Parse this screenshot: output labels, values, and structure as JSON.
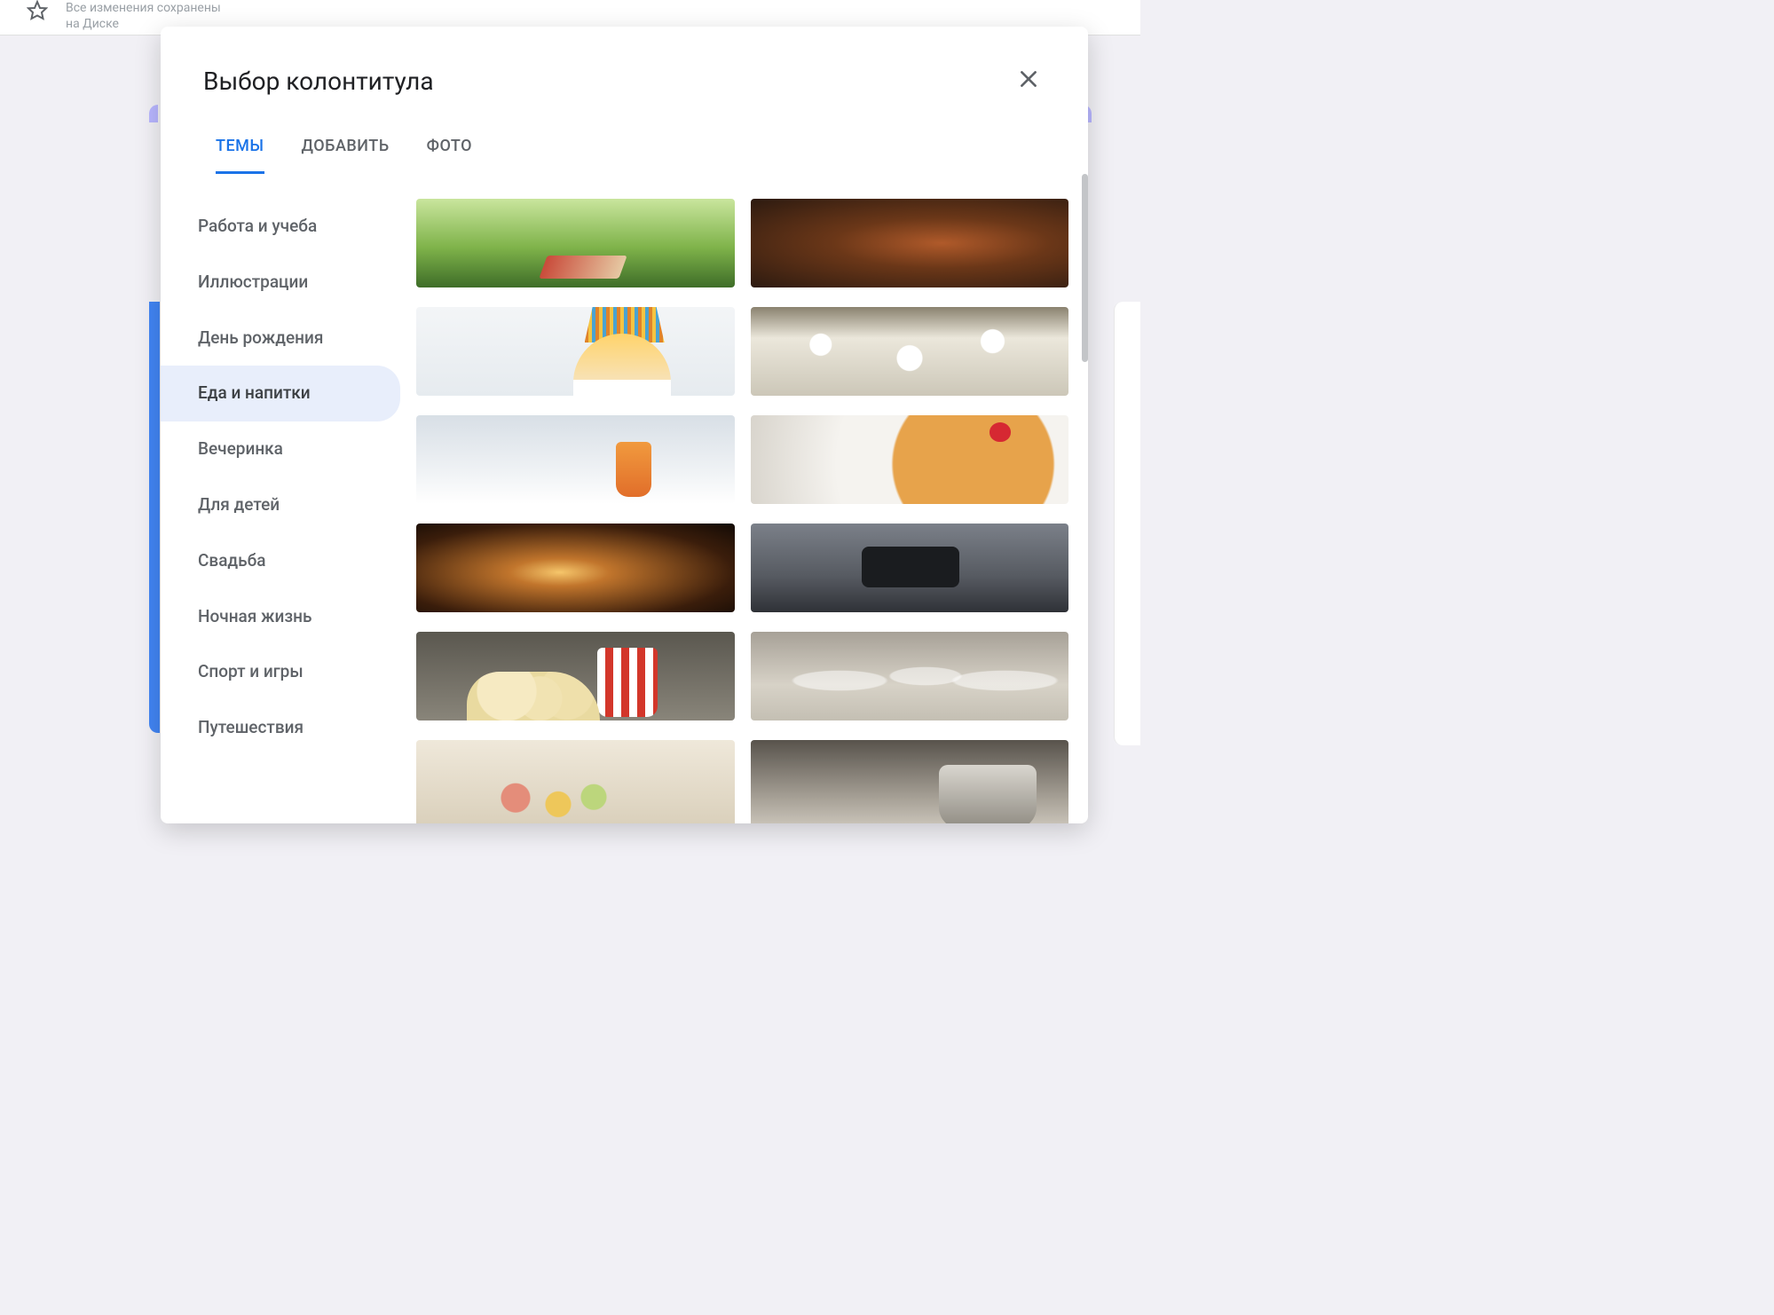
{
  "topbar": {
    "save_status_line1": "Все изменения сохранены",
    "save_status_line2": "на Диске"
  },
  "modal": {
    "title": "Выбор колонтитула",
    "tabs": [
      {
        "label": "ТЕМЫ",
        "active": true
      },
      {
        "label": "ДОБАВИТЬ",
        "active": false
      },
      {
        "label": "ФОТО",
        "active": false
      }
    ],
    "categories": [
      {
        "label": "Работа и учеба",
        "selected": false
      },
      {
        "label": "Иллюстрации",
        "selected": false
      },
      {
        "label": "День рождения",
        "selected": false
      },
      {
        "label": "Еда и напитки",
        "selected": true
      },
      {
        "label": "Вечеринка",
        "selected": false
      },
      {
        "label": "Для детей",
        "selected": false
      },
      {
        "label": "Свадьба",
        "selected": false
      },
      {
        "label": "Ночная жизнь",
        "selected": false
      },
      {
        "label": "Спорт и игры",
        "selected": false
      },
      {
        "label": "Путешествия",
        "selected": false
      }
    ],
    "thumbnails": [
      {
        "name": "picnic"
      },
      {
        "name": "steak-grill"
      },
      {
        "name": "birthday-cake"
      },
      {
        "name": "dinner-table-topdown"
      },
      {
        "name": "cocktails"
      },
      {
        "name": "pancakes"
      },
      {
        "name": "candlelit-dinner"
      },
      {
        "name": "party-topdown"
      },
      {
        "name": "popcorn"
      },
      {
        "name": "champagne-glasses"
      },
      {
        "name": "tea-pastries"
      },
      {
        "name": "cooking-pot"
      }
    ]
  }
}
